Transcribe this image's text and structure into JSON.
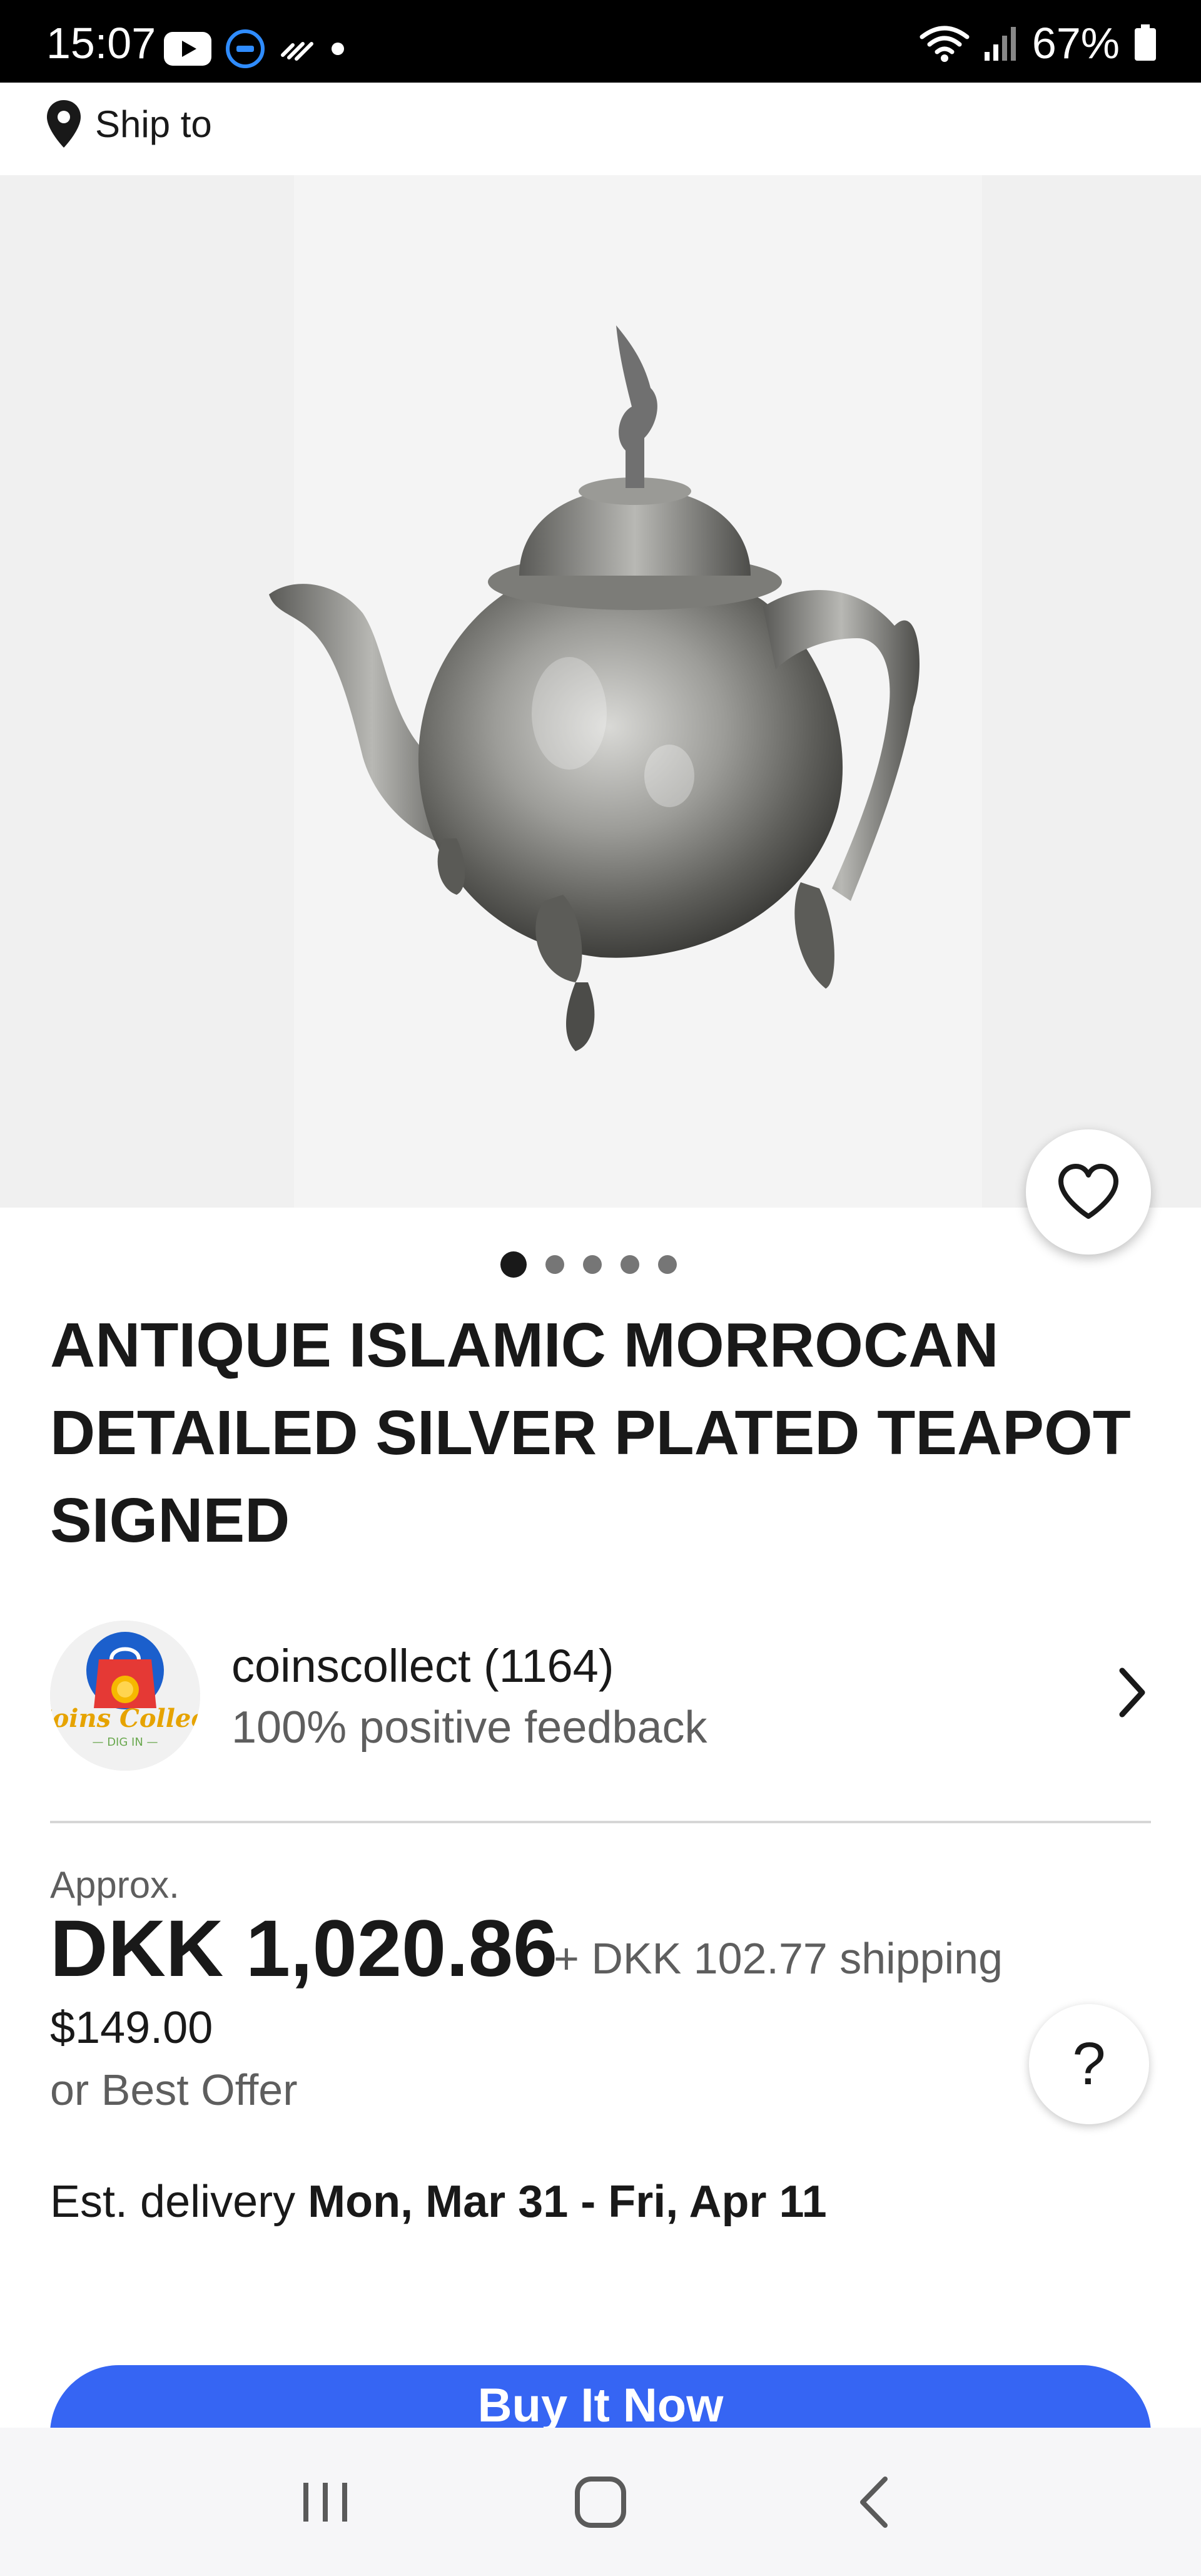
{
  "status_bar": {
    "time": "15:07",
    "battery": "67%"
  },
  "ship_to": {
    "label": "Ship to"
  },
  "gallery": {
    "image_count": 5,
    "active_index": 0,
    "image_alt": "silver plated teapot"
  },
  "listing": {
    "title": "ANTIQUE ISLAMIC MORROCAN DETAILED SILVER PLATED TEAPOT SIGNED"
  },
  "seller": {
    "name": "coinscollect (1164)",
    "feedback": "100% positive feedback",
    "logo_text": "Coins Collect",
    "logo_subtext": "DIG IN"
  },
  "price": {
    "approx_label": "Approx.",
    "amount": "DKK 1,020.86",
    "shipping": "+ DKK 102.77 shipping",
    "usd": "$149.00",
    "best_offer": "or Best Offer"
  },
  "delivery": {
    "label": "Est. delivery",
    "dates": "Mon, Mar 31 - Fri, Apr 11"
  },
  "buy_button": {
    "label": "Buy It Now"
  },
  "help_button": {
    "label": "?"
  },
  "colors": {
    "accent_blue": "#3665f3",
    "text_primary": "#191919",
    "text_secondary": "#5e5e5e"
  }
}
